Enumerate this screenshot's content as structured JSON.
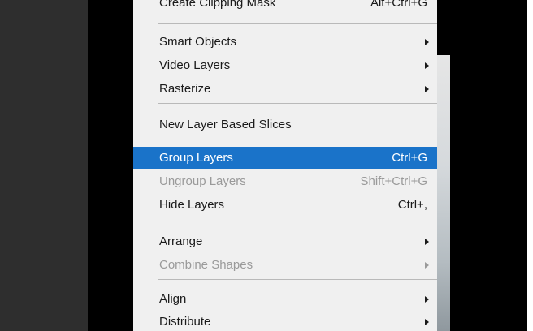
{
  "menu": {
    "partial_item": {
      "label": "Create Clipping Mask",
      "shortcut": "Alt+Ctrl+G"
    },
    "group1": [
      {
        "label": "Smart Objects"
      },
      {
        "label": "Video Layers"
      },
      {
        "label": "Rasterize"
      }
    ],
    "slices": {
      "label": "New Layer Based Slices"
    },
    "group_layers": {
      "label": "Group Layers",
      "shortcut": "Ctrl+G"
    },
    "ungroup_layers": {
      "label": "Ungroup Layers",
      "shortcut": "Shift+Ctrl+G"
    },
    "hide_layers": {
      "label": "Hide Layers",
      "shortcut": "Ctrl+,"
    },
    "arrange": {
      "label": "Arrange"
    },
    "combine_shapes": {
      "label": "Combine Shapes"
    },
    "align": {
      "label": "Align"
    },
    "distribute": {
      "label": "Distribute"
    }
  },
  "colors": {
    "highlight": "#1a73c9",
    "menu_background": "#f0f0f0",
    "disabled_text": "#9a9a9a"
  }
}
